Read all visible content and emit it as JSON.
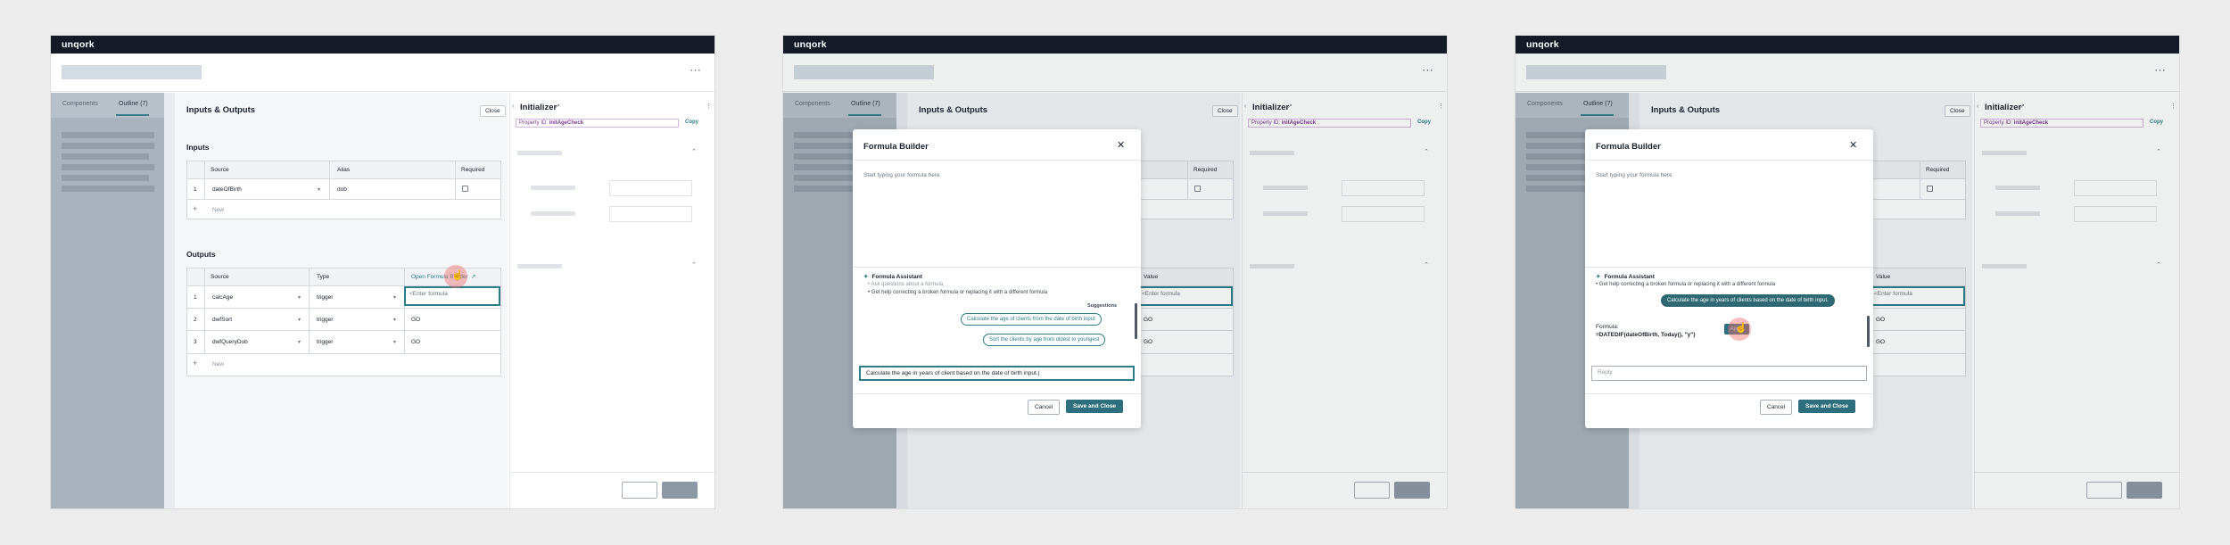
{
  "app": {
    "logo": "unqork",
    "menu_icon": "ellipsis-icon"
  },
  "sidebar": {
    "tabs": [
      "Components",
      "Outline (7)"
    ]
  },
  "io_panel": {
    "title": "Inputs & Outputs",
    "close_label": "Close",
    "inputs_label": "Inputs",
    "inputs_headers": [
      "Source",
      "Alias",
      "Required"
    ],
    "inputs_rows": [
      {
        "no": "1",
        "source": "dateOfBirth",
        "alias": "dob"
      }
    ],
    "new_label": "New",
    "outputs_label": "Outputs",
    "outputs_headers": [
      "Source",
      "Type",
      "Value"
    ],
    "open_formula_builder": "Open Formula Builder",
    "outputs_rows": [
      {
        "no": "1",
        "source": "calcAge",
        "type": "trigger",
        "value": "<Enter formula"
      },
      {
        "no": "2",
        "source": "dwfSort",
        "type": "trigger",
        "value": "GO"
      },
      {
        "no": "3",
        "source": "dwfQueryDob",
        "type": "trigger",
        "value": "GO"
      }
    ],
    "value_placeholder": "Enter formula"
  },
  "right_panel": {
    "title": "Initializer",
    "property_id_label": "Property ID:",
    "property_id_value": "initAgeCheck",
    "copy_label": "Copy"
  },
  "modal": {
    "title": "Formula Builder",
    "placeholder": "Start typing your formula here",
    "assistant_title": "Formula Assistant",
    "bullets_partial": [
      "Ask questions about a formula",
      "Get help correcting a broken formula or replacing it with a different formula"
    ],
    "bullet_3": "Get help correcting a broken formula or replacing it with a different formula",
    "suggestions_label": "Suggestions",
    "suggestions": [
      "Calculate the age of clients from the date of birth input",
      "Sort the clients by age from oldest to youngest"
    ],
    "chat_input_2": "Calculate the age in years of client based on the date of birth input.|",
    "user_message_3": "Calculate the age in years of clients based on the date of birth input.",
    "formula_label": "Formula:",
    "formula_value": "=DATEDIF(dateOfBirth, Today(), \"y\")",
    "apply_label": "Apply",
    "reply_placeholder": "Reply",
    "cancel_label": "Cancel",
    "save_label": "Save and Close"
  }
}
